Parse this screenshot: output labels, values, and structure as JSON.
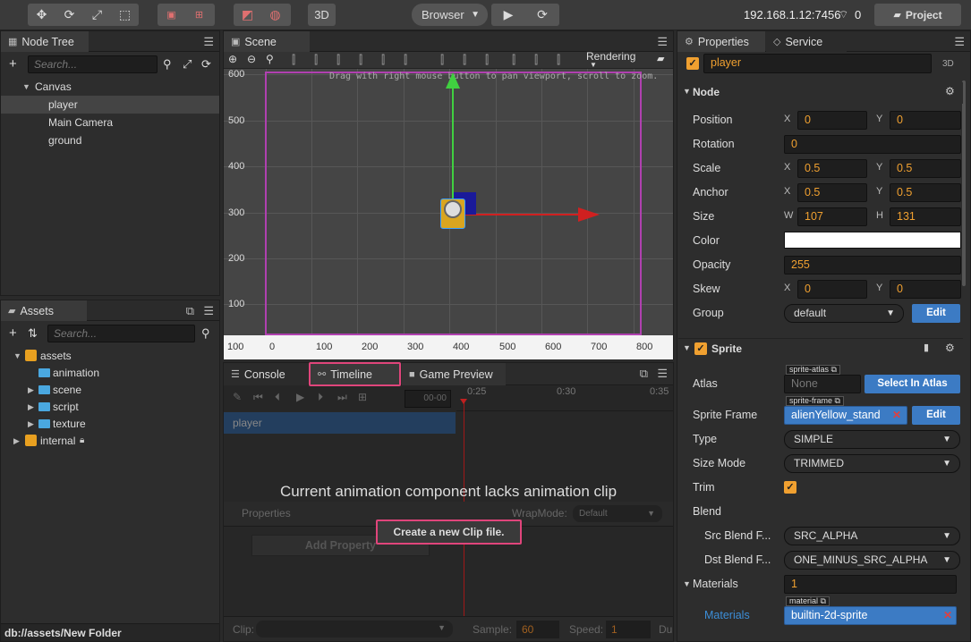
{
  "topbar": {
    "host": "192.168.1.12:7456",
    "wifi_count": "0",
    "browser_label": "Browser",
    "btn_3d": "3D",
    "project_label": "Project"
  },
  "node_tree": {
    "title": "Node Tree",
    "search_placeholder": "Search...",
    "items": [
      "Canvas",
      "player",
      "Main Camera",
      "ground"
    ]
  },
  "assets": {
    "title": "Assets",
    "search_placeholder": "Search...",
    "items": [
      "assets",
      "animation",
      "scene",
      "script",
      "texture",
      "internal"
    ],
    "status_path": "db://assets/New Folder"
  },
  "scene": {
    "title": "Scene",
    "rendering_label": "Rendering",
    "hint": "Drag with right mouse button to pan viewport, scroll to zoom.",
    "y_ticks": [
      "600",
      "500",
      "400",
      "300",
      "200",
      "100"
    ],
    "x_ticks": [
      "100",
      "0",
      "100",
      "200",
      "300",
      "400",
      "500",
      "600",
      "700",
      "800"
    ]
  },
  "bottom": {
    "tabs": [
      "Console",
      "Timeline",
      "Game Preview"
    ],
    "time_value": "00-00",
    "times": [
      "0:25",
      "0:30",
      "0:35"
    ],
    "track_name": "player",
    "message": "Current animation component lacks animation clip",
    "properties_label": "Properties",
    "wrapmode_label": "WrapMode:",
    "wrapmode_value": "Default",
    "add_property": "Add Property",
    "create_clip": "Create a new Clip file.",
    "clip_label": "Clip:",
    "sample_label": "Sample:",
    "sample_value": "60",
    "speed_label": "Speed:",
    "speed_value": "1",
    "du_label": "Du"
  },
  "properties": {
    "tabs": [
      "Properties",
      "Service"
    ],
    "node_name": "player",
    "btn_3d": "3D",
    "node_section": "Node",
    "position": {
      "label": "Position",
      "x": "0",
      "y": "0"
    },
    "rotation": {
      "label": "Rotation",
      "value": "0"
    },
    "scale": {
      "label": "Scale",
      "x": "0.5",
      "y": "0.5"
    },
    "anchor": {
      "label": "Anchor",
      "x": "0.5",
      "y": "0.5"
    },
    "size": {
      "label": "Size",
      "w": "107",
      "h": "131"
    },
    "color": {
      "label": "Color",
      "value": "#ffffff"
    },
    "opacity": {
      "label": "Opacity",
      "value": "255"
    },
    "skew": {
      "label": "Skew",
      "x": "0",
      "y": "0"
    },
    "group": {
      "label": "Group",
      "value": "default",
      "edit": "Edit"
    },
    "sprite_section": "Sprite",
    "atlas": {
      "label": "Atlas",
      "tag": "sprite-atlas",
      "value": "None",
      "button": "Select In Atlas"
    },
    "sprite_frame": {
      "label": "Sprite Frame",
      "tag": "sprite-frame",
      "value": "alienYellow_stand",
      "edit": "Edit"
    },
    "type": {
      "label": "Type",
      "value": "SIMPLE"
    },
    "size_mode": {
      "label": "Size Mode",
      "value": "TRIMMED"
    },
    "trim": {
      "label": "Trim"
    },
    "blend": {
      "label": "Blend"
    },
    "src_blend": {
      "label": "Src Blend F...",
      "value": "SRC_ALPHA"
    },
    "dst_blend": {
      "label": "Dst Blend F...",
      "value": "ONE_MINUS_SRC_ALPHA"
    },
    "materials": {
      "label": "Materials",
      "count": "1",
      "sub_label": "Materials",
      "tag": "material",
      "value": "builtin-2d-sprite"
    }
  },
  "labels": {
    "x": "X",
    "y": "Y",
    "w": "W",
    "h": "H"
  },
  "colors": {
    "accent": "#f0a030",
    "select": "#3c7bc4",
    "highlight": "#e0457b",
    "gizmo_frame": "#b040b0"
  }
}
